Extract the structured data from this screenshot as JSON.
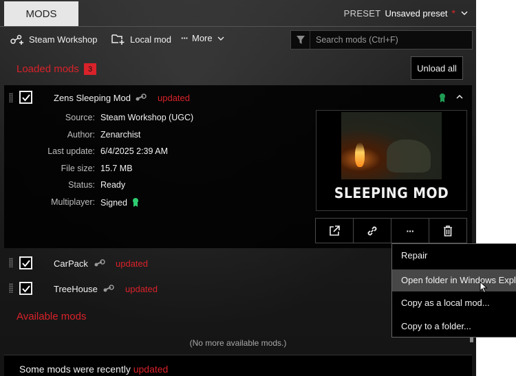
{
  "header": {
    "tab_label": "MODS",
    "preset_label": "PRESET",
    "preset_value": "Unsaved preset",
    "preset_modified_marker": "*"
  },
  "toolbar": {
    "steam_workshop": "Steam Workshop",
    "local_mod": "Local mod",
    "more": "More",
    "search_placeholder": "Search mods (Ctrl+F)"
  },
  "loaded": {
    "title": "Loaded mods",
    "count": "3",
    "unload_all": "Unload all",
    "mods": [
      {
        "name": "Zens Sleeping Mod",
        "status": "updated",
        "checked": true,
        "expanded": true,
        "details": [
          {
            "label": "Source:",
            "value": "Steam Workshop (UGC)"
          },
          {
            "label": "Author:",
            "value": "Zenarchist"
          },
          {
            "label": "Last update:",
            "value": "6/4/2025 2:39 AM"
          },
          {
            "label": "File size:",
            "value": "15.7 MB"
          },
          {
            "label": "Status:",
            "value": "Ready"
          },
          {
            "label": "Multiplayer:",
            "value": "Signed"
          }
        ],
        "thumbnail_text": "SLEEPING MOD"
      },
      {
        "name": "CarPack",
        "status": "updated",
        "checked": true
      },
      {
        "name": "TreeHouse",
        "status": "updated",
        "checked": true
      }
    ]
  },
  "context_menu": {
    "items": [
      "Repair",
      "Open folder in Windows Explo",
      "Copy as a local mod...",
      "Copy to a folder..."
    ],
    "hovered_index": 1
  },
  "available": {
    "title": "Available mods",
    "empty_text": "(No more available mods.)"
  },
  "footer": {
    "text": "Some mods were recently",
    "highlight": "updated"
  },
  "colors": {
    "accent_red": "#d9222a",
    "signed_green": "#2ecc71",
    "background": "#1c1c1c"
  },
  "icons": [
    "steam-workshop-icon",
    "local-mod-icon",
    "more-dots-icon",
    "chevron-down-icon",
    "filter-icon",
    "checkmark-icon",
    "steam-logo-icon",
    "signed-badge-icon",
    "chevron-up-icon",
    "external-link-icon",
    "link-icon",
    "ellipsis-icon",
    "trash-icon"
  ]
}
